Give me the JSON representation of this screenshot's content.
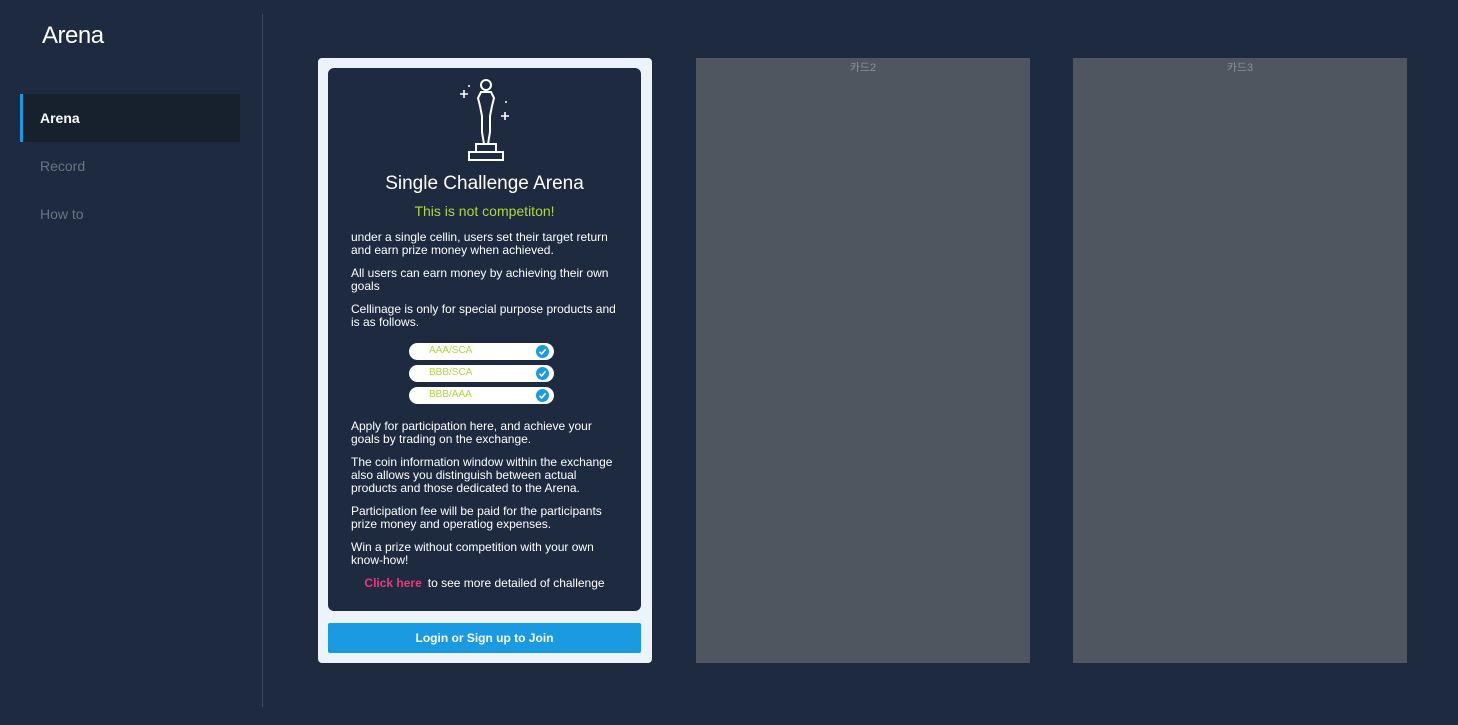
{
  "app": {
    "title": "Arena"
  },
  "sidebar": {
    "items": [
      {
        "label": "Arena",
        "active": true
      },
      {
        "label": "Record",
        "active": false
      },
      {
        "label": "How to",
        "active": false
      }
    ]
  },
  "card1": {
    "icon": "trophy-icon",
    "title": "Single Challenge Arena",
    "subtitle": "This is not competiton!",
    "paragraphs": [
      "under a single cellin, users set their target return and earn prize money when achieved.",
      "All users can earn money by achieving their own goals",
      "Cellinage is only for special purpose products and is as follows.",
      "Apply for participation here, and achieve your goals by trading on the exchange.",
      "The coin information window within the exchange also allows you distinguish between actual products and those dedicated to the Arena.",
      "Participation fee will be paid for the participants prize money and operatiog expenses.",
      "Win a prize without competition with your own know-how!"
    ],
    "products": [
      "AAA/SCA",
      "BBB/SCA",
      "BBB/AAA"
    ],
    "click_link": "Click here",
    "click_text": "to see more detailed of challenge",
    "join_button": "Login or Sign up to Join"
  },
  "card2": {
    "label": "카드2"
  },
  "card3": {
    "label": "카드3"
  },
  "colors": {
    "background": "#1d2a3f",
    "accent": "#1a9ae0",
    "highlight": "#b4d43e",
    "link": "#e83a7c",
    "placeholder_card": "#4f5660"
  }
}
